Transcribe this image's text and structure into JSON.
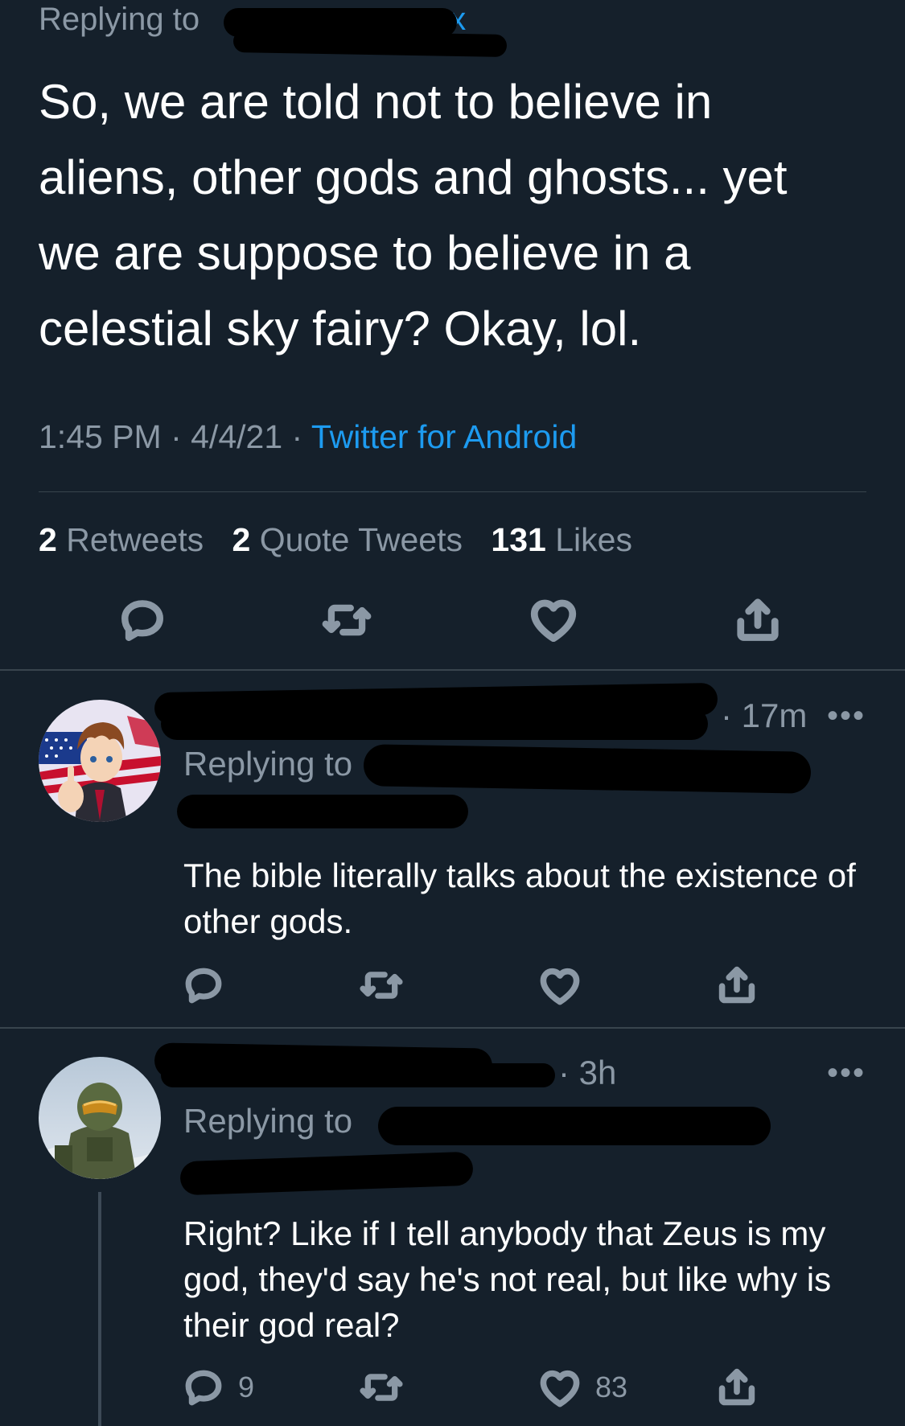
{
  "main_tweet": {
    "replying_to": "Replying to",
    "replying_fragment": "x",
    "text": "So, we are told not to believe in aliens, other gods and ghosts... yet we are suppose to believe in a celestial sky fairy? Okay, lol.",
    "time": "1:45 PM · 4/4/21 ·",
    "source": "Twitter for Android",
    "stats": {
      "retweets_count": "2",
      "retweets_label": "Retweets",
      "quotes_count": "2",
      "quotes_label": "Quote Tweets",
      "likes_count": "131",
      "likes_label": "Likes"
    }
  },
  "replies": [
    {
      "time": "· 17m",
      "more": "•••",
      "replying_to": "Replying to",
      "text": "The bible literally talks about the existence of other gods.",
      "reply_count": "",
      "like_count": ""
    },
    {
      "time": "· 3h",
      "more": "•••",
      "replying_to": "Replying to",
      "text": "Right? Like if I tell anybody that Zeus is my god, they'd say he's not real, but like why is their god real?",
      "reply_count": "9",
      "like_count": "83"
    }
  ],
  "colors": {
    "background": "#15202b",
    "muted": "#8b98a5",
    "link": "#1d9bf0",
    "divider": "#38444d"
  },
  "icons": [
    "reply-icon",
    "retweet-icon",
    "like-icon",
    "share-icon",
    "more-icon"
  ]
}
